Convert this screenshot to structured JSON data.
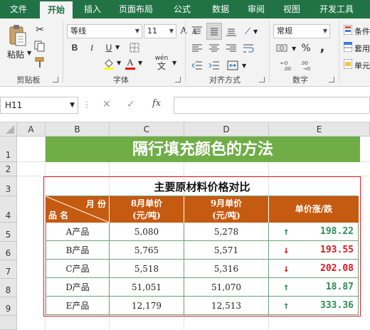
{
  "tabs": [
    {
      "label": "文件",
      "active": false
    },
    {
      "label": "开始",
      "active": true
    },
    {
      "label": "插入",
      "active": false
    },
    {
      "label": "页面布局",
      "active": false
    },
    {
      "label": "公式",
      "active": false
    },
    {
      "label": "数据",
      "active": false
    },
    {
      "label": "审阅",
      "active": false
    },
    {
      "label": "视图",
      "active": false
    },
    {
      "label": "开发工具",
      "active": false
    }
  ],
  "ribbon": {
    "clipboard": {
      "paste_label": "粘贴",
      "group_label": "剪贴板"
    },
    "font": {
      "name": "等线",
      "size": "11",
      "group_label": "字体",
      "bold": "B",
      "italic": "I",
      "underline": "U",
      "grow": "A",
      "shrink": "A",
      "color_letter": "A",
      "phonetic": "wén"
    },
    "alignment": {
      "group_label": "对齐方式"
    },
    "number": {
      "format": "常规",
      "group_label": "数字",
      "percent": "%",
      "comma": ","
    },
    "styles": {
      "cond_format": "条件",
      "table_format": "套用",
      "cell_style": "单元"
    }
  },
  "formula_bar": {
    "name_box": "H11",
    "cancel": "✕",
    "enter": "✓",
    "fx": "fx",
    "content": ""
  },
  "columns": [
    "A",
    "B",
    "C",
    "D",
    "E"
  ],
  "rows": [
    "1",
    "2",
    "3",
    "4",
    "5",
    "6",
    "7",
    "8",
    "9"
  ],
  "sheet": {
    "title": "隔行填充颜色的方法",
    "table_title": "主要原材料价格对比",
    "header": {
      "corner_top": "月 份",
      "corner_bottom": "品 名",
      "aug_line1": "8月单价",
      "aug_line2": "(元/吨)",
      "sep_line1": "9月单价",
      "sep_line2": "(元/吨)",
      "change": "单价涨/跌"
    },
    "items": [
      {
        "name": "A产品",
        "aug": "5,080",
        "sep": "5,278",
        "dir": "↑",
        "change": "198.22",
        "up": true
      },
      {
        "name": "B产品",
        "aug": "5,765",
        "sep": "5,571",
        "dir": "↓",
        "change": "193.55",
        "up": false
      },
      {
        "name": "C产品",
        "aug": "5,518",
        "sep": "5,316",
        "dir": "↓",
        "change": "202.08",
        "up": false
      },
      {
        "name": "D产品",
        "aug": "51,051",
        "sep": "51,070",
        "dir": "↑",
        "change": "18.87",
        "up": true
      },
      {
        "name": "E产品",
        "aug": "12,179",
        "sep": "12,513",
        "dir": "↑",
        "change": "333.36",
        "up": true
      }
    ]
  },
  "colors": {
    "ribbon_green": "#217346",
    "title_green": "#70ad47",
    "header_orange": "#c55a11",
    "up_green": "#2e8b57",
    "down_red": "#e0141e"
  }
}
